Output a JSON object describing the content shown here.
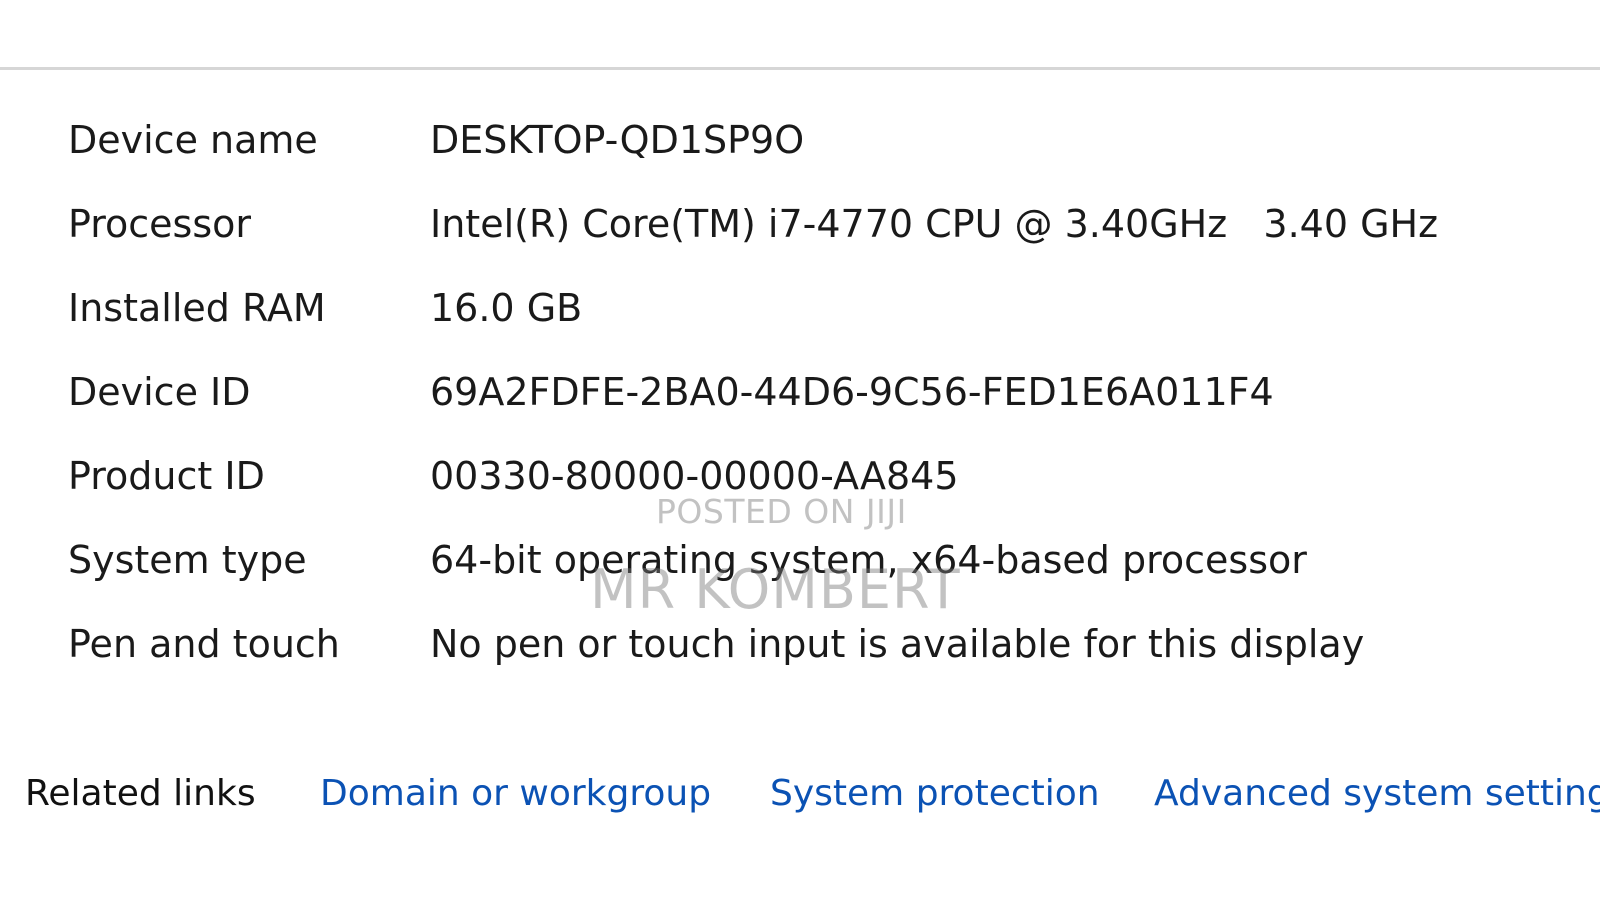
{
  "specs": [
    {
      "label": "Device name",
      "value": "DESKTOP-QD1SP9O"
    },
    {
      "label": "Processor",
      "value": "Intel(R) Core(TM) i7-4770 CPU @ 3.40GHz   3.40 GHz"
    },
    {
      "label": "Installed RAM",
      "value": "16.0 GB"
    },
    {
      "label": "Device ID",
      "value": "69A2FDFE-2BA0-44D6-9C56-FED1E6A011F4"
    },
    {
      "label": "Product ID",
      "value": "00330-80000-00000-AA845"
    },
    {
      "label": "System type",
      "value": "64-bit operating system, x64-based processor"
    },
    {
      "label": "Pen and touch",
      "value": "No pen or touch input is available for this display"
    }
  ],
  "related_links": {
    "title": "Related links",
    "links": [
      {
        "label": "Domain or workgroup"
      },
      {
        "label": "System protection"
      },
      {
        "label": "Advanced system settings"
      }
    ]
  },
  "watermark": {
    "line1": "POSTED ON JIJI",
    "line2": "MR KOMBERT"
  },
  "colors": {
    "link": "#0b52b4",
    "divider": "#d6d6d6",
    "text": "#1a1a1a"
  }
}
